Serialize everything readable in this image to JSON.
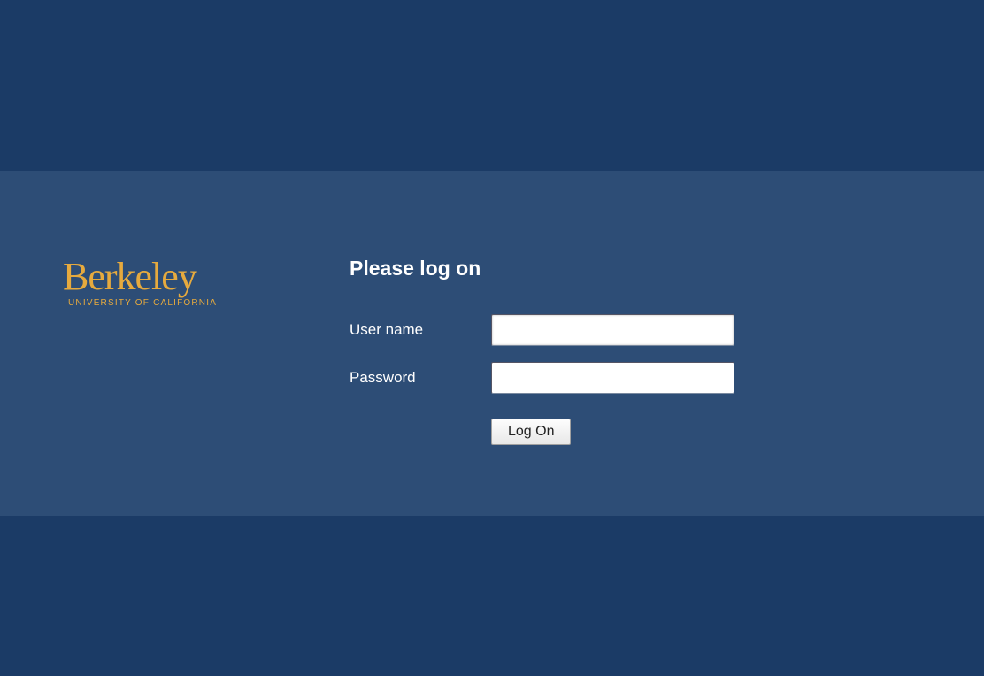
{
  "brand": {
    "name": "Berkeley",
    "subtitle": "UNIVERSITY OF CALIFORNIA",
    "color": "#e6aa3e"
  },
  "form": {
    "title": "Please log on",
    "username_label": "User name",
    "username_value": "",
    "password_label": "Password",
    "password_value": "",
    "submit_label": "Log On"
  },
  "colors": {
    "background_dark": "#1b3b66",
    "background_light": "#2d4d76",
    "text_light": "#ffffff"
  }
}
